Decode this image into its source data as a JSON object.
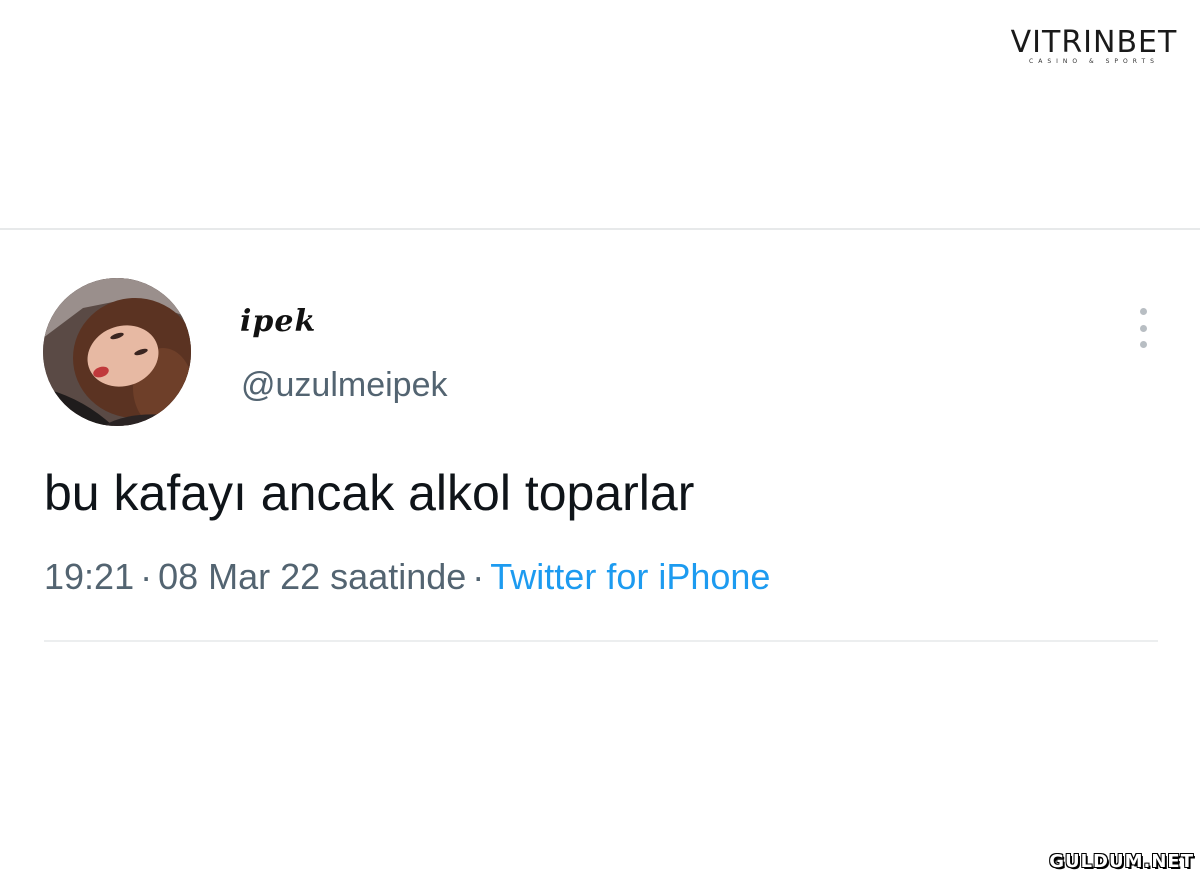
{
  "watermark": {
    "brand": "VITRINBET",
    "tagline": "CASINO & SPORTS",
    "site": "GULDUM.NET"
  },
  "tweet": {
    "display_name": "ipek",
    "handle": "@uzulmeipek",
    "text": "bu kafayı ancak alkol toparlar",
    "time": "19:21",
    "date": "08 Mar 22 saatinde",
    "separator": "·",
    "source": "Twitter for iPhone"
  },
  "icons": {
    "more": "more-vertical-icon",
    "avatar": "profile-avatar"
  },
  "colors": {
    "text": "#0f1419",
    "muted": "#536471",
    "link": "#1d9bf0",
    "divider": "#e7e9ea"
  }
}
